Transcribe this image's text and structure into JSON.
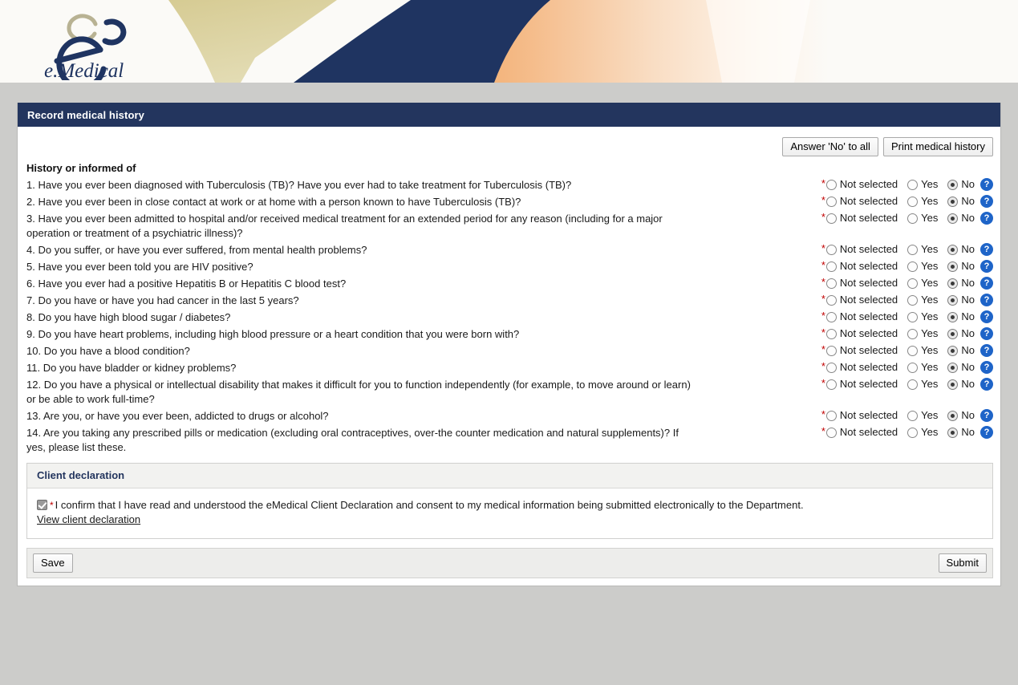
{
  "brand": {
    "logo_text": "e.Medical",
    "navy": "#23355e",
    "gold": "#d9cf9a",
    "peach": "#f5c08f",
    "required_red": "#c00000",
    "help_blue": "#1e64c8"
  },
  "panel": {
    "title": "Record medical history"
  },
  "toolbar": {
    "answer_no_label": "Answer 'No' to all",
    "print_label": "Print medical history"
  },
  "questions_section": {
    "title": "History or informed of",
    "options": {
      "not_selected": "Not selected",
      "yes": "Yes",
      "no": "No"
    },
    "help_glyph": "?",
    "required_marker": "*",
    "items": [
      {
        "number": "1.",
        "text": "Have you ever been diagnosed with Tuberculosis (TB)? Have you ever had to take treatment for Tuberculosis (TB)?",
        "selected": "No",
        "wide": false
      },
      {
        "number": "2.",
        "text": "Have you ever been in close contact at work or at home with a person known to have Tuberculosis (TB)?",
        "selected": "No",
        "wide": false
      },
      {
        "number": "3.",
        "text": "Have you ever been admitted to hospital and/or received medical treatment for an extended period for any reason (including for a major operation or treatment of a psychiatric illness)?",
        "selected": "No",
        "wide": false
      },
      {
        "number": "4.",
        "text": "Do you suffer, or have you ever suffered, from mental health problems?",
        "selected": "No",
        "wide": false
      },
      {
        "number": "5.",
        "text": "Have you ever been told you are HIV positive?",
        "selected": "No",
        "wide": false
      },
      {
        "number": "6.",
        "text": "Have you ever had a positive Hepatitis B or Hepatitis C blood test?",
        "selected": "No",
        "wide": false
      },
      {
        "number": "7.",
        "text": "Do you have or have you had cancer in the last 5 years?",
        "selected": "No",
        "wide": false
      },
      {
        "number": "8.",
        "text": "Do you have high blood sugar / diabetes?",
        "selected": "No",
        "wide": false
      },
      {
        "number": "9.",
        "text": "Do you have heart problems, including high blood pressure or a heart condition that you were born with?",
        "selected": "No",
        "wide": false
      },
      {
        "number": "10.",
        "text": "Do you have a blood condition?",
        "selected": "No",
        "wide": false
      },
      {
        "number": "11.",
        "text": "Do you have bladder or kidney problems?",
        "selected": "No",
        "wide": false
      },
      {
        "number": "12.",
        "text": "Do you have a physical or intellectual disability that makes it difficult for you to function independently (for example, to move around or learn) or be able to work full-time?",
        "selected": "No",
        "wide": true
      },
      {
        "number": "13.",
        "text": "Are you, or have you ever been, addicted to drugs or alcohol?",
        "selected": "No",
        "wide": false
      },
      {
        "number": "14.",
        "text": "Are you taking any prescribed pills or medication (excluding oral contraceptives, over-the counter medication and natural supplements)? If yes, please list these.",
        "selected": "No",
        "wide": false
      }
    ]
  },
  "declaration": {
    "title": "Client declaration",
    "required_marker": "*",
    "checked": true,
    "text": "I confirm that I have read and understood the eMedical Client Declaration and consent to my medical information being submitted electronically to the Department.",
    "link_label": "View client declaration"
  },
  "footer": {
    "save_label": "Save",
    "submit_label": "Submit"
  }
}
